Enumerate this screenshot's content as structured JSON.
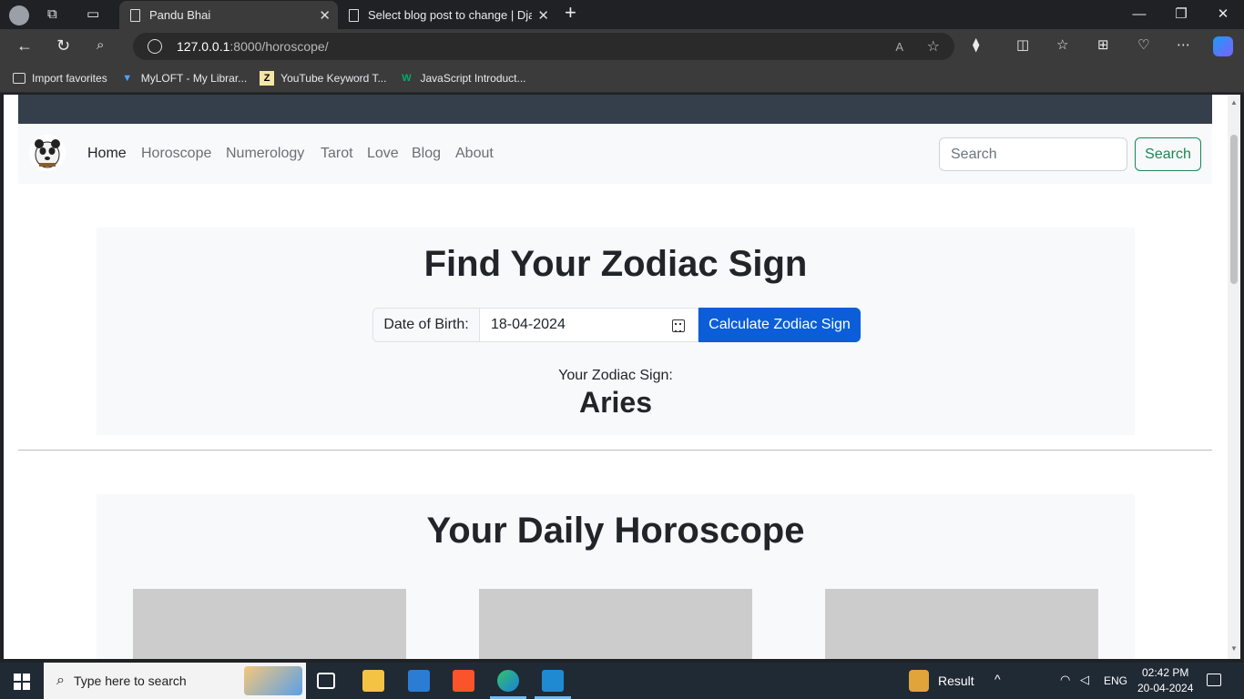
{
  "browser": {
    "tabs": [
      {
        "title": "Pandu Bhai",
        "active": true
      },
      {
        "title": "Select blog post to change | Djar",
        "active": false
      }
    ],
    "new_tab_symbol": "+",
    "close_symbol": "✕",
    "address": {
      "host": "127.0.0.1",
      "rest": ":8000/horoscope/"
    },
    "bookmarks": [
      {
        "label": "Import favorites",
        "icon": "import-favorites-icon"
      },
      {
        "label": "MyLOFT - My Librar...",
        "icon": "myloft-icon"
      },
      {
        "label": "YouTube Keyword T...",
        "icon": "zoho-icon",
        "icon_text": "Z"
      },
      {
        "label": "JavaScript Introduct...",
        "icon": "w3-icon",
        "icon_text": "W"
      }
    ],
    "window_controls": {
      "minimize": "—",
      "restore": "❐",
      "close": "✕"
    }
  },
  "page": {
    "nav": {
      "links": [
        "Home",
        "Horoscope",
        "Numerology",
        "Tarot",
        "Love",
        "Blog",
        "About"
      ],
      "active": "Home",
      "search_placeholder": "Search",
      "search_button": "Search"
    },
    "zodiac": {
      "title": "Find Your Zodiac Sign",
      "dob_label": "Date of Birth:",
      "dob_value": "18-04-2024",
      "button": "Calculate Zodiac Sign",
      "result_label": "Your Zodiac Sign:",
      "result_value": "Aries"
    },
    "daily": {
      "title": "Your Daily Horoscope"
    }
  },
  "taskbar": {
    "search_placeholder": "Type here to search",
    "weather_label": "Result",
    "language": "ENG",
    "time": "02:42 PM",
    "date": "20-04-2024"
  },
  "colors": {
    "primary_button": "#0b5ed7",
    "success_outline": "#198754",
    "top_band": "#343f4b",
    "card_bg": "#f8f9fa"
  }
}
